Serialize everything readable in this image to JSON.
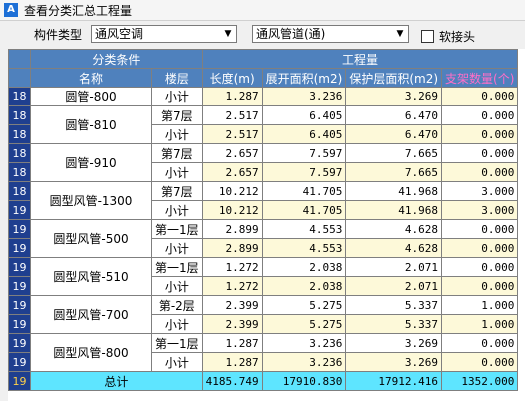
{
  "window": {
    "title": "查看分类汇总工程量",
    "app_icon_letter": "A"
  },
  "toolbar": {
    "type_label": "构件类型",
    "combo1_value": "通风空调",
    "combo2_value": "通风管道(通)",
    "soft_joint_label": "软接头",
    "arrow": "▼"
  },
  "table": {
    "group_headers": {
      "category": "分类条件",
      "quantity": "工程量"
    },
    "columns": {
      "name": "名称",
      "floor": "楼层",
      "length": "长度(m)",
      "unfold_area": "展开面积(m2)",
      "protect_area": "保护层面积(m2)",
      "support_count": "支架数量(个)"
    },
    "rows": [
      {
        "no": "18",
        "name": "圆管-800",
        "floor": "小计",
        "length": "1.287",
        "unfold": "3.236",
        "protect": "3.269",
        "support": "0.000",
        "subtotal": true
      },
      {
        "no": "18",
        "name": "圆管-810",
        "floor": "第7层",
        "length": "2.517",
        "unfold": "6.405",
        "protect": "6.470",
        "support": "0.000",
        "subtotal": false
      },
      {
        "no": "18",
        "name": "",
        "floor": "小计",
        "length": "2.517",
        "unfold": "6.405",
        "protect": "6.470",
        "support": "0.000",
        "subtotal": true
      },
      {
        "no": "18",
        "name": "圆管-910",
        "floor": "第7层",
        "length": "2.657",
        "unfold": "7.597",
        "protect": "7.665",
        "support": "0.000",
        "subtotal": false
      },
      {
        "no": "18",
        "name": "",
        "floor": "小计",
        "length": "2.657",
        "unfold": "7.597",
        "protect": "7.665",
        "support": "0.000",
        "subtotal": true
      },
      {
        "no": "18",
        "name": "圆型风管-1300",
        "floor": "第7层",
        "length": "10.212",
        "unfold": "41.705",
        "protect": "41.968",
        "support": "3.000",
        "subtotal": false
      },
      {
        "no": "19",
        "name": "",
        "floor": "小计",
        "length": "10.212",
        "unfold": "41.705",
        "protect": "41.968",
        "support": "3.000",
        "subtotal": true
      },
      {
        "no": "19",
        "name": "圆型风管-500",
        "floor": "第一1层",
        "length": "2.899",
        "unfold": "4.553",
        "protect": "4.628",
        "support": "0.000",
        "subtotal": false
      },
      {
        "no": "19",
        "name": "",
        "floor": "小计",
        "length": "2.899",
        "unfold": "4.553",
        "protect": "4.628",
        "support": "0.000",
        "subtotal": true
      },
      {
        "no": "19",
        "name": "圆型风管-510",
        "floor": "第一1层",
        "length": "1.272",
        "unfold": "2.038",
        "protect": "2.071",
        "support": "0.000",
        "subtotal": false
      },
      {
        "no": "19",
        "name": "",
        "floor": "小计",
        "length": "1.272",
        "unfold": "2.038",
        "protect": "2.071",
        "support": "0.000",
        "subtotal": true
      },
      {
        "no": "19",
        "name": "圆型风管-700",
        "floor": "第-2层",
        "length": "2.399",
        "unfold": "5.275",
        "protect": "5.337",
        "support": "1.000",
        "subtotal": false
      },
      {
        "no": "19",
        "name": "",
        "floor": "小计",
        "length": "2.399",
        "unfold": "5.275",
        "protect": "5.337",
        "support": "1.000",
        "subtotal": true
      },
      {
        "no": "19",
        "name": "圆型风管-800",
        "floor": "第一1层",
        "length": "1.287",
        "unfold": "3.236",
        "protect": "3.269",
        "support": "0.000",
        "subtotal": false
      },
      {
        "no": "19",
        "name": "",
        "floor": "小计",
        "length": "1.287",
        "unfold": "3.236",
        "protect": "3.269",
        "support": "0.000",
        "subtotal": true
      }
    ],
    "total": {
      "no": "19",
      "label": "总计",
      "length": "4185.749",
      "unfold": "17910.830",
      "protect": "17912.416",
      "support": "1352.000"
    }
  }
}
